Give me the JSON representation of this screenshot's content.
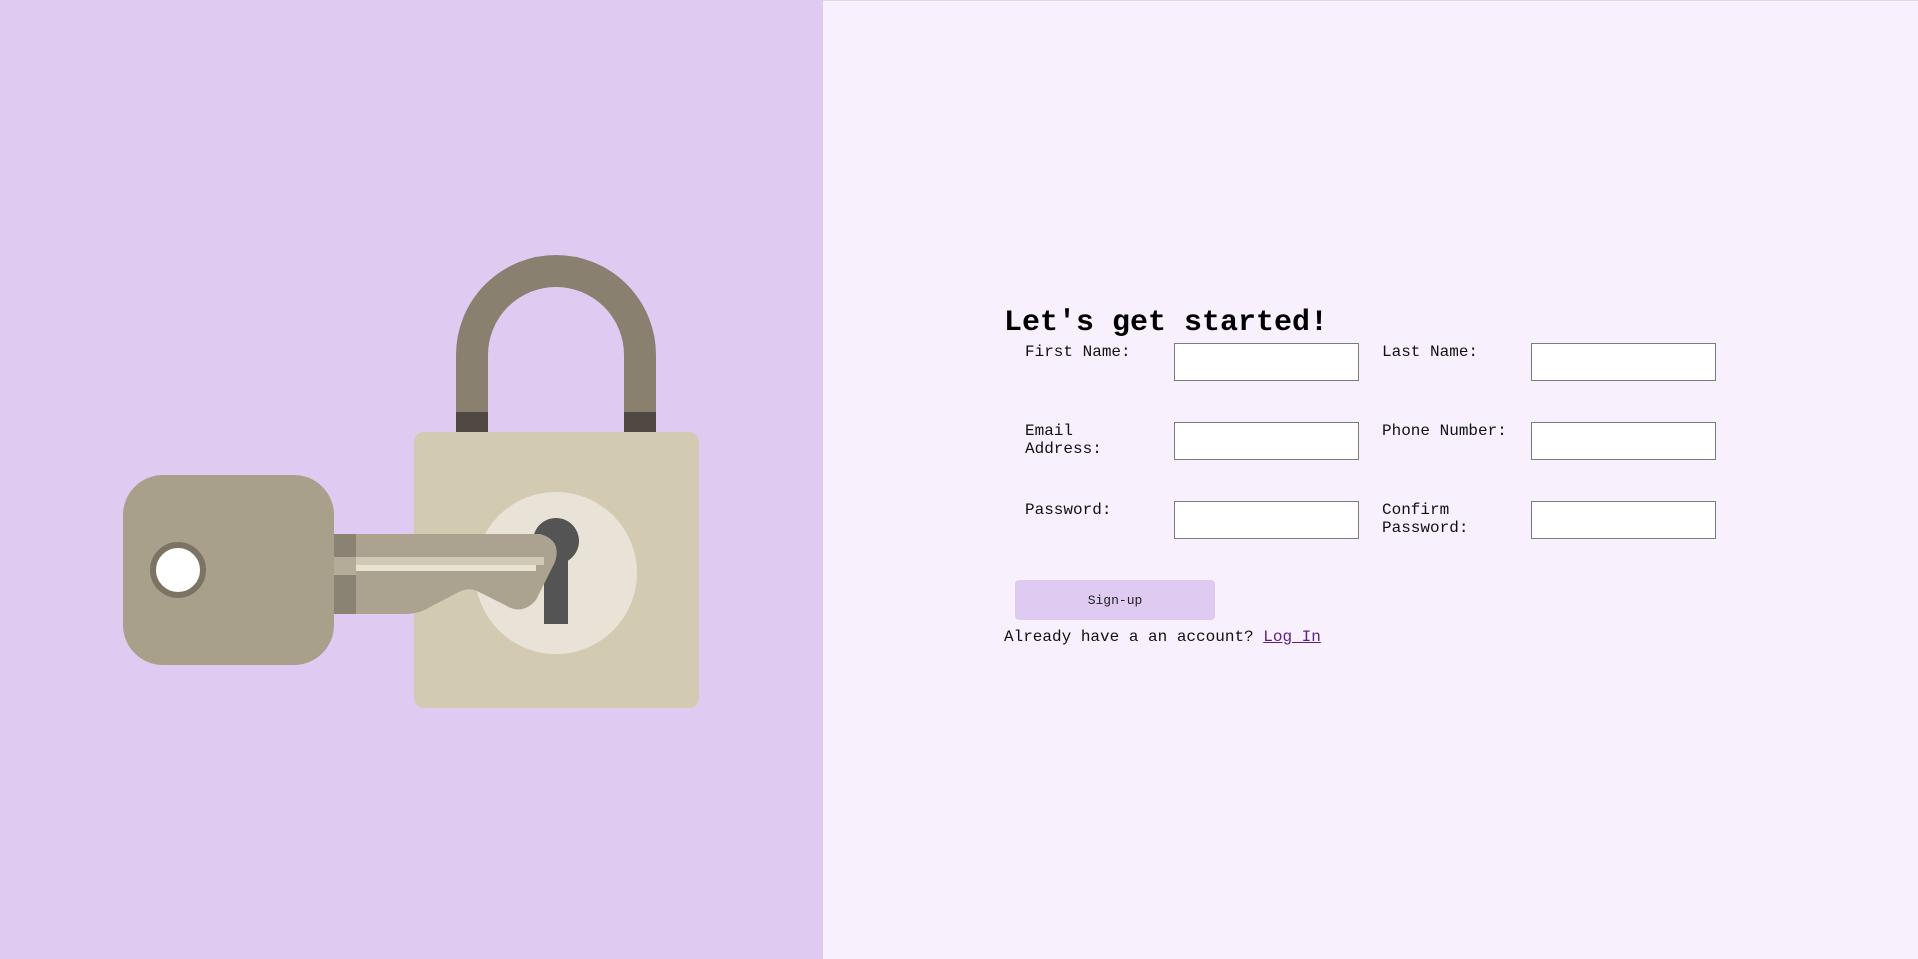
{
  "form": {
    "title": "Let's get started!",
    "fields": {
      "first_name": {
        "label": "First Name:",
        "value": ""
      },
      "last_name": {
        "label": "Last Name:",
        "value": ""
      },
      "email": {
        "label": "Email Address:",
        "value": ""
      },
      "phone": {
        "label": "Phone Number:",
        "value": ""
      },
      "password": {
        "label": "Password:",
        "value": ""
      },
      "confirm_password": {
        "label": "Confirm Password:",
        "value": ""
      }
    },
    "signup_label": "Sign-up",
    "already_text": "Already have a an account?",
    "login_label": "Log In"
  },
  "colors": {
    "left_panel": "#dfcbf2",
    "right_panel": "#f8f0fd",
    "button": "#dfcbf2",
    "link": "#5a1f84"
  },
  "illustration": {
    "lock_icon": "padlock-icon",
    "key_icon": "key-icon"
  }
}
